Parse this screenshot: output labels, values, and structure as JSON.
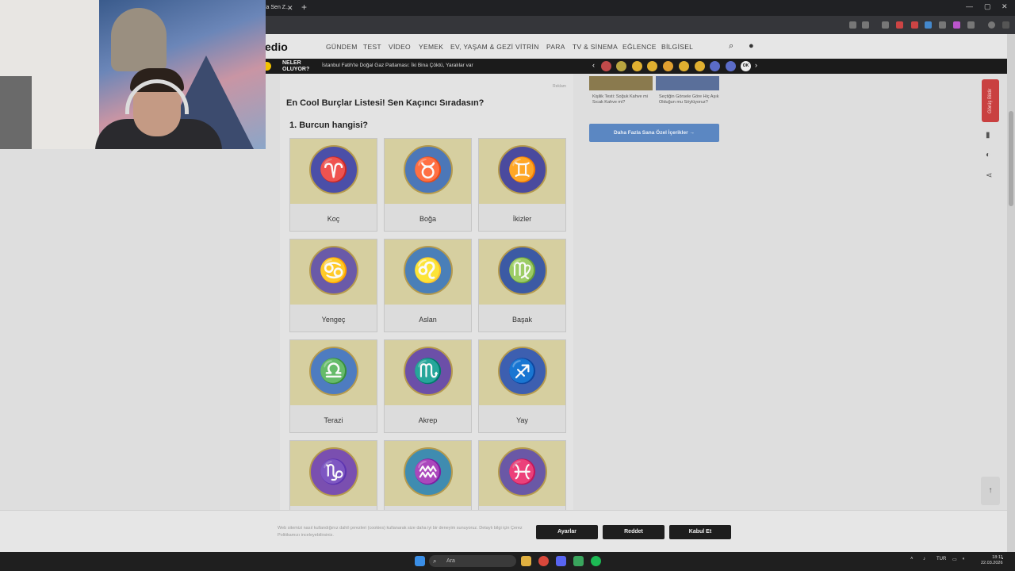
{
  "browser": {
    "tab_title": "la Sen Z...",
    "tab_close": "✕",
    "new_tab": "+",
    "window_controls": [
      "—",
      "▢",
      "✕"
    ]
  },
  "site": {
    "logo": "edio",
    "nav": [
      "GÜNDEM",
      "TEST",
      "VİDEO",
      "YEMEK",
      "EV, YAŞAM & GEZİ",
      "VİTRİN",
      "PARA",
      "TV & SİNEMA",
      "EĞLENCE",
      "BİLGİSEL"
    ],
    "search_icon": "search-icon",
    "user_icon": "user-icon"
  },
  "news_bar": {
    "label_line1": "NELER",
    "label_line2": "OLUYOR?",
    "headline": "İstanbul Fatih'te Doğal Gaz Patlaması: İki Bina Çöktü, Yaralılar var",
    "prev": "‹",
    "next": "›",
    "ok_badge": "OK"
  },
  "article": {
    "reklam": "Reklam",
    "title": "En Cool Burçlar Listesi! Sen Kaçıncı Sıradasın?",
    "question": "1. Burcun hangisi?",
    "options": [
      {
        "label": "Koç",
        "glyph": "♈",
        "bg": "#4b4fa8"
      },
      {
        "label": "Boğa",
        "glyph": "♉",
        "bg": "#4c77b8"
      },
      {
        "label": "İkizler",
        "glyph": "♊",
        "bg": "#4a4a9e"
      },
      {
        "label": "Yengeç",
        "glyph": "♋",
        "bg": "#6a5aa8"
      },
      {
        "label": "Aslan",
        "glyph": "♌",
        "bg": "#4a7fb8"
      },
      {
        "label": "Başak",
        "glyph": "♍",
        "bg": "#3c5aa4"
      },
      {
        "label": "Terazi",
        "glyph": "♎",
        "bg": "#4e7cc0"
      },
      {
        "label": "Akrep",
        "glyph": "♏",
        "bg": "#6c4fa8"
      },
      {
        "label": "Yay",
        "glyph": "♐",
        "bg": "#3d5fb0"
      },
      {
        "label": "",
        "glyph": "♑",
        "bg": "#7a4fb0"
      },
      {
        "label": "",
        "glyph": "♒",
        "bg": "#3f8cb0"
      },
      {
        "label": "",
        "glyph": "♓",
        "bg": "#6a58a6"
      }
    ]
  },
  "sidebar": {
    "items": [
      {
        "text": "Kişilik Testi: Soğuk Kahve mi Sıcak Kahve mi?"
      },
      {
        "text": "Seçtiğin Görsele Göre Hiç Aşık Olduğun mu Söylüyoruz?"
      }
    ],
    "more_button": "Daha Fazla Sana Özel İçerikler  →",
    "report_button": "Görüş Bildir",
    "to_top": "↑"
  },
  "cookie": {
    "text": "Web sitemizi nasıl kullandığınız dahil çerezleri (cookies) kullanarak size daha iyi bir deneyim sunuyoruz. Detaylı bilgi için Çerez Politikamızı inceleyebilirsiniz.",
    "settings": "Ayarlar",
    "reject": "Reddet",
    "accept": "Kabul Et"
  },
  "taskbar": {
    "search_placeholder": "Ara",
    "lang": "TUR",
    "time": "18:11",
    "date": "22.03.2026"
  }
}
